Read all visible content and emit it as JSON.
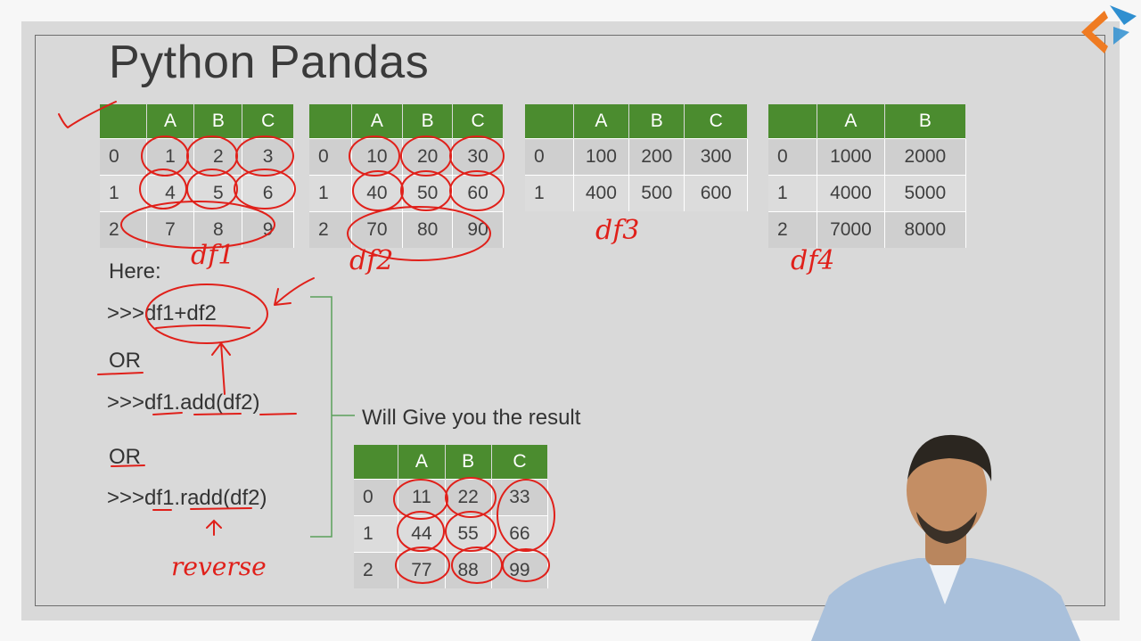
{
  "slide": {
    "title": "Python Pandas",
    "here_label": "Here:",
    "code1": ">>>df1+df2",
    "or1": "OR",
    "code2": ">>>df1.add(df2)",
    "or2": "OR",
    "code3": ">>>df1.radd(df2)",
    "result_label": "Will Give you the result"
  },
  "tables": {
    "df1": {
      "columns": [
        "",
        "A",
        "B",
        "C"
      ],
      "rows": [
        [
          "0",
          "1",
          "2",
          "3"
        ],
        [
          "1",
          "4",
          "5",
          "6"
        ],
        [
          "2",
          "7",
          "8",
          "9"
        ]
      ]
    },
    "df2": {
      "columns": [
        "",
        "A",
        "B",
        "C"
      ],
      "rows": [
        [
          "0",
          "10",
          "20",
          "30"
        ],
        [
          "1",
          "40",
          "50",
          "60"
        ],
        [
          "2",
          "70",
          "80",
          "90"
        ]
      ]
    },
    "df3": {
      "columns": [
        "",
        "A",
        "B",
        "C"
      ],
      "rows": [
        [
          "0",
          "100",
          "200",
          "300"
        ],
        [
          "1",
          "400",
          "500",
          "600"
        ]
      ]
    },
    "df4": {
      "columns": [
        "",
        "A",
        "B"
      ],
      "rows": [
        [
          "0",
          "1000",
          "2000"
        ],
        [
          "1",
          "4000",
          "5000"
        ],
        [
          "2",
          "7000",
          "8000"
        ]
      ]
    },
    "result": {
      "columns": [
        "",
        "A",
        "B",
        "C"
      ],
      "rows": [
        [
          "0",
          "11",
          "22",
          "33"
        ],
        [
          "1",
          "44",
          "55",
          "66"
        ],
        [
          "2",
          "77",
          "88",
          "99"
        ]
      ]
    }
  },
  "annotations": {
    "df1_label": "df1",
    "df2_label": "df2",
    "df3_label": "df3",
    "df4_label": "df4",
    "reverse_label": "reverse"
  },
  "colors": {
    "header_green": "#4b8c2f",
    "ink_red": "#e0201a",
    "slide_bg": "#d9d9d9",
    "bracket_green": "#5aa05a"
  }
}
